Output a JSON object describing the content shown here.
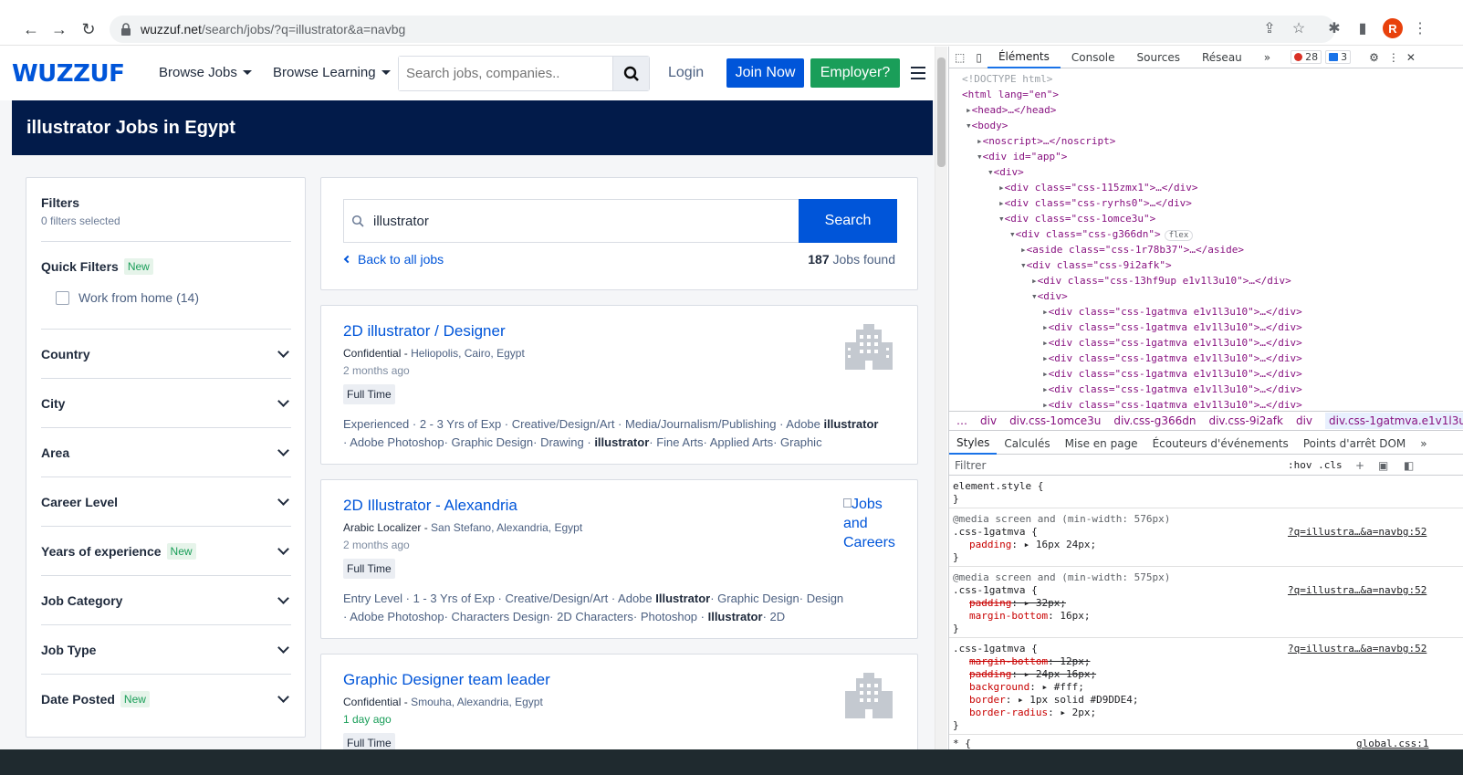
{
  "browser": {
    "url_host": "wuzzuf.net",
    "url_path": "/search/jobs/?q=illustrator&a=navbg",
    "profile_initial": "R"
  },
  "header": {
    "logo": "WUZZUF",
    "browse_jobs": "Browse Jobs",
    "browse_learning": "Browse Learning",
    "search_placeholder": "Search jobs, companies..",
    "login": "Login",
    "join_now": "Join Now",
    "employer": "Employer?"
  },
  "banner_title": "illustrator Jobs in Egypt",
  "filters": {
    "title": "Filters",
    "selected": "0 filters selected",
    "quick_filters": "Quick Filters",
    "new_badge": "New",
    "work_from_home": "Work from home (14)",
    "sections": [
      {
        "label": "Country",
        "new": ""
      },
      {
        "label": "City",
        "new": ""
      },
      {
        "label": "Area",
        "new": ""
      },
      {
        "label": "Career Level",
        "new": ""
      },
      {
        "label": "Years of experience",
        "new": "New"
      },
      {
        "label": "Job Category",
        "new": ""
      },
      {
        "label": "Job Type",
        "new": ""
      },
      {
        "label": "Date Posted",
        "new": "New"
      }
    ]
  },
  "search": {
    "query": "illustrator",
    "button": "Search",
    "back": "Back to all jobs",
    "count": "187",
    "count_suffix": "Jobs found"
  },
  "jobs": [
    {
      "title": "2D illustrator / Designer",
      "company": "Confidential -",
      "location": "Heliopolis, Cairo, Egypt",
      "posted": "2 months ago",
      "type": "Full Time",
      "skills_line1": "Experienced · 2 - 3 Yrs of Exp · Creative/Design/Art · Media/Journalism/Publishing · Adobe ",
      "skills_line1_bold": "illustrator",
      "skills_line2a": "· Adobe Photoshop· Graphic Design· Drawing · ",
      "skills_line2_bold": "illustrator",
      "skills_line2b": "· Fine Arts· Applied Arts· Graphic"
    },
    {
      "title": "2D Illustrator - Alexandria",
      "company": "Arabic Localizer -",
      "location": "San Stefano, Alexandria, Egypt",
      "posted": "2 months ago",
      "type": "Full Time",
      "logo_alt": "Jobs and Careers",
      "skills_line1": "Entry Level · 1 - 3 Yrs of Exp · Creative/Design/Art · Adobe ",
      "skills_line1_bold": "Illustrator",
      "skills_line1_tail": "· Graphic Design· Design",
      "skills_line2a": "· Adobe Photoshop· Characters Design· 2D Characters· Photoshop · ",
      "skills_line2_bold": "Illustrator",
      "skills_line2b": "· 2D"
    },
    {
      "title": "Graphic Designer team leader",
      "company": "Confidential -",
      "location": "Smouha, Alexandria, Egypt",
      "posted": "1 day ago",
      "type": "Full Time"
    }
  ],
  "devtools": {
    "tabs": [
      "Éléments",
      "Console",
      "Sources",
      "Réseau"
    ],
    "more": "»",
    "errors": "28",
    "messages": "3",
    "dom": [
      "<!DOCTYPE html>",
      "<html lang=\"en\">",
      "<head>…</head>",
      "<body>",
      "<noscript>…</noscript>",
      "<div id=\"app\">",
      "<div>",
      "<div class=\"css-115zmx1\">…</div>",
      "<div class=\"css-ryrhs0\">…</div>",
      "<div class=\"css-1omce3u\">",
      "<div class=\"css-g366dn\">",
      "<aside class=\"css-1r78b37\">…</aside>",
      "<div class=\"css-9i2afk\">",
      "<div class=\"css-13hf9up e1v1l3u10\">…</div>",
      "<div>",
      "<div class=\"css-1gatmva e1v1l3u10\">…</div>"
    ],
    "flex_badge": "flex",
    "breadcrumbs": [
      "…",
      "div",
      "div.css-1omce3u",
      "div.css-g366dn",
      "div.css-9i2afk",
      "div",
      "div.css-1gatmva.e1v1l3u10"
    ],
    "style_tabs": [
      "Styles",
      "Calculés",
      "Mise en page",
      "Écouteurs d'événements",
      "Points d'arrêt DOM",
      "»"
    ],
    "filter_placeholder": "Filtrer",
    "filter_tools": ":hov  .cls",
    "rules": {
      "element_style": "element.style {",
      "close": "}",
      "media1": "@media screen and (min-width: 576px)",
      "media2": "@media screen and (min-width: 575px)",
      "selector": ".css-1gatmva {",
      "src": "?q=illustra…&a=navbg:52",
      "padding1": "padding",
      "padding1_val": ": ▸ 16px 24px;",
      "padding2_val": ": ▸ 32px;",
      "margin_bottom": "margin-bottom",
      "margin_bottom_val": ": 16px;",
      "mb_12": ": 12px;",
      "padding3_val": ": ▸ 24px 16px;",
      "background": "background",
      "background_val": ": ▸ #fff;",
      "border": "border",
      "border_val": ": ▸ 1px solid #D9DDE4;",
      "border_radius": "border-radius",
      "border_radius_val": ": ▸ 2px;",
      "universal": "* {",
      "global_src": "global.css:1"
    }
  }
}
